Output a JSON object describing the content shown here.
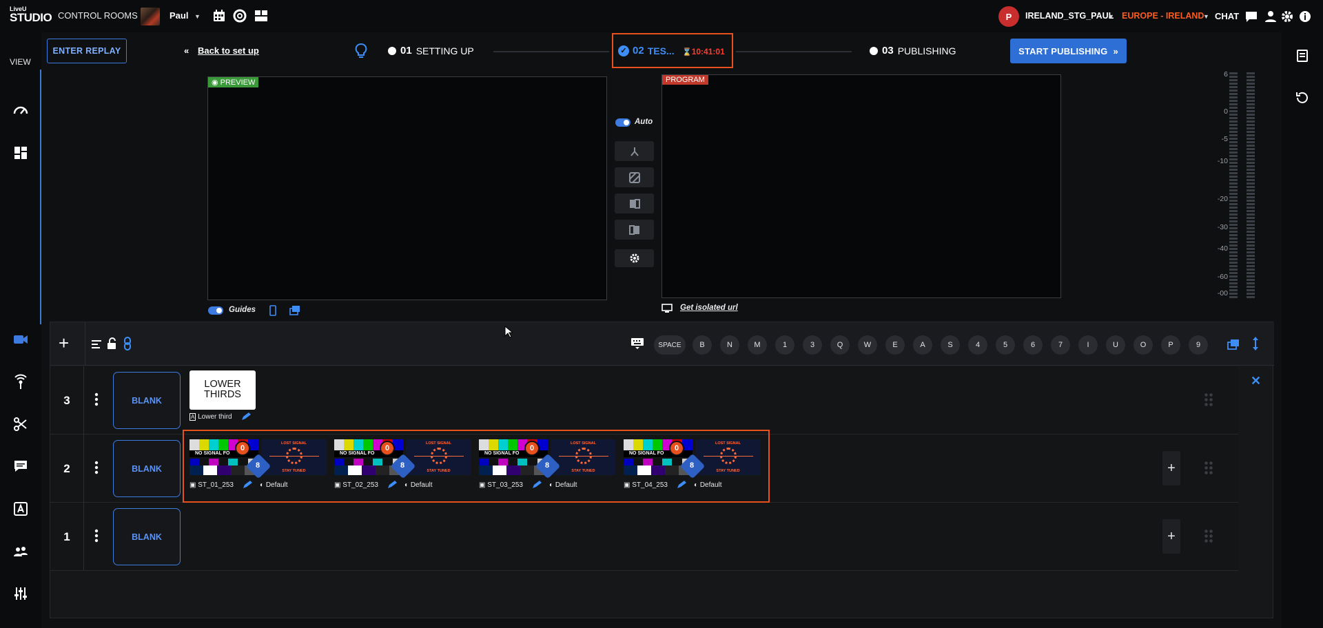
{
  "topbar": {
    "logo_top": "LiveU",
    "logo_bottom": "STUDIO",
    "control_rooms": "CONTROL ROOMS",
    "user": "Paul",
    "avatar_letter": "P",
    "account": "IRELAND_STG_PAUL",
    "region": "EUROPE - IRELAND",
    "chat": "CHAT"
  },
  "sidebar": {
    "view_label": "VIEW"
  },
  "steps": {
    "replay_button": "ENTER REPLAY",
    "back": "Back to set up",
    "step1_num": "01",
    "step1_label": "SETTING UP",
    "step2_num": "02",
    "step2_label": "TES...",
    "step2_timer": "10:41:01",
    "step3_num": "03",
    "step3_label": "PUBLISHING",
    "publish_button": "START PUBLISHING"
  },
  "monitors": {
    "preview_label": "PREVIEW",
    "program_label": "PROGRAM",
    "auto_label": "Auto",
    "guides_label": "Guides",
    "isolated_url": "Get isolated url"
  },
  "audio_meter": {
    "ticks": [
      "6",
      "0",
      "-5",
      "-10",
      "-20",
      "-30",
      "-40",
      "-60",
      "-00"
    ]
  },
  "shortcut_keys": [
    "SPACE",
    "B",
    "N",
    "M",
    "1",
    "3",
    "Q",
    "W",
    "E",
    "A",
    "S",
    "4",
    "5",
    "6",
    "7",
    "I",
    "U",
    "O",
    "P",
    "9"
  ],
  "layers": {
    "row3": {
      "num": "3",
      "blank": "BLANK",
      "lower_thirds_line1": "LOWER",
      "lower_thirds_line2": "THIRDS",
      "lower_caption": "Lower third"
    },
    "row2": {
      "num": "2",
      "blank": "BLANK",
      "sources": [
        {
          "name": "ST_01_253",
          "badge": "0",
          "profile": "Default",
          "thumb_text": "NO SIGNAL FO",
          "lost_top": "LOST SIGNAL",
          "lost_bottom": "STAY TUNED"
        },
        {
          "name": "ST_02_253",
          "badge": "0",
          "profile": "Default",
          "thumb_text": "NO SIGNAL FO",
          "lost_top": "LOST SIGNAL",
          "lost_bottom": "STAY TUNED"
        },
        {
          "name": "ST_03_253",
          "badge": "0",
          "profile": "Default",
          "thumb_text": "NO SIGNAL FO",
          "lost_top": "LOST SIGNAL",
          "lost_bottom": "STAY TUNED"
        },
        {
          "name": "ST_04_253",
          "badge": "0",
          "profile": "Default",
          "thumb_text": "NO SIGNAL FO",
          "lost_top": "LOST SIGNAL",
          "lost_bottom": "STAY TUNED"
        }
      ]
    },
    "row1": {
      "num": "1",
      "blank": "BLANK"
    }
  },
  "colors": {
    "accent": "#3e7be0",
    "highlight": "#e8501e",
    "region": "#ff5a1f",
    "preview": "#3a9a3a",
    "program": "#c0392b"
  }
}
